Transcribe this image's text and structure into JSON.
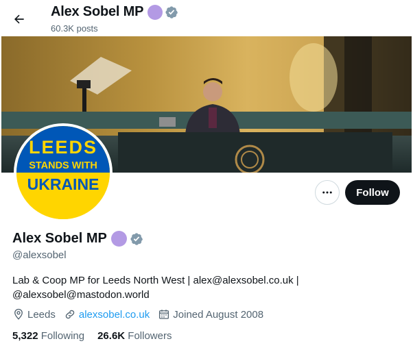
{
  "header": {
    "name": "Alex Sobel MP",
    "posts": "60.3K posts"
  },
  "banner": {
    "description": "speaker at United Nations podium"
  },
  "avatar": {
    "line1": "LEEDS",
    "line2": "STANDS WITH",
    "line3": "UKRAINE",
    "colors": {
      "blue": "#0057b7",
      "yellow": "#ffd500"
    }
  },
  "actions": {
    "follow_label": "Follow"
  },
  "profile": {
    "name": "Alex Sobel MP",
    "handle": "@alexsobel",
    "bio_line1": "Lab & Coop MP for Leeds North West | alex@alexsobel.co.uk |",
    "bio_line2": "@alexsobel@mastodon.world",
    "location": "Leeds",
    "website": "alexsobel.co.uk",
    "joined": "Joined August 2008"
  },
  "stats": {
    "following_count": "5,322",
    "following_label": "Following",
    "followers_count": "26.6K",
    "followers_label": "Followers"
  },
  "icons": {
    "back": "arrow-left-icon",
    "verified": "verified-badge-icon",
    "more": "ellipsis-icon",
    "location": "location-pin-icon",
    "link": "link-icon",
    "calendar": "calendar-icon"
  },
  "colors": {
    "verified": "#829aab",
    "purple_badge": "#b39ae4",
    "link": "#1d9bf0",
    "follow_bg": "#0f1419"
  }
}
